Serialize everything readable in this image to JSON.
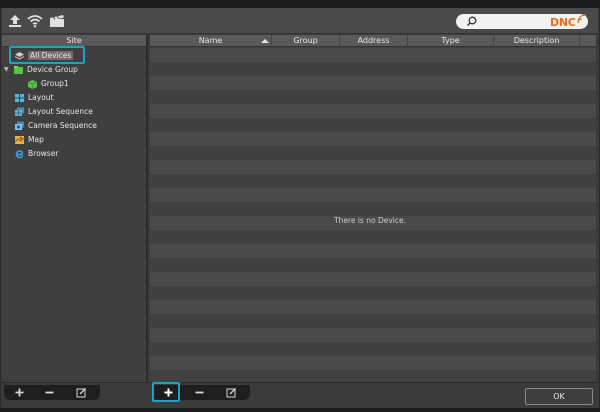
{
  "brand": {
    "text": "DNC",
    "color": "#e86b1c"
  },
  "toolbar": {
    "icons": [
      "upload-icon",
      "wifi-icon",
      "clapperboard-icon"
    ],
    "search": {
      "placeholder": ""
    }
  },
  "left_pane": {
    "header": "Site",
    "tree": [
      {
        "label": "All Devices",
        "icon": "layers-icon",
        "selected": true
      },
      {
        "label": "Device Group",
        "icon": "folder-cube-icon",
        "expanded": true
      },
      {
        "label": "Group1",
        "icon": "cube-icon"
      },
      {
        "label": "Layout",
        "icon": "layout-grid-icon"
      },
      {
        "label": "Layout Sequence",
        "icon": "layout-sequence-icon"
      },
      {
        "label": "Camera Sequence",
        "icon": "camera-sequence-icon"
      },
      {
        "label": "Map",
        "icon": "map-icon"
      },
      {
        "label": "Browser",
        "icon": "browser-icon"
      }
    ]
  },
  "grid": {
    "columns": [
      "Name",
      "Group",
      "Address",
      "Type",
      "Description"
    ],
    "sorted_column": "Name",
    "empty_message": "There is no Device."
  },
  "bottom": {
    "left_buttons": [
      "add",
      "remove",
      "edit"
    ],
    "right_buttons": [
      "add",
      "remove",
      "edit"
    ],
    "ok_label": "OK"
  },
  "colors": {
    "highlight": "#1fa0c7",
    "panel": "#3f3f3f",
    "header": "#5a5a5a"
  }
}
